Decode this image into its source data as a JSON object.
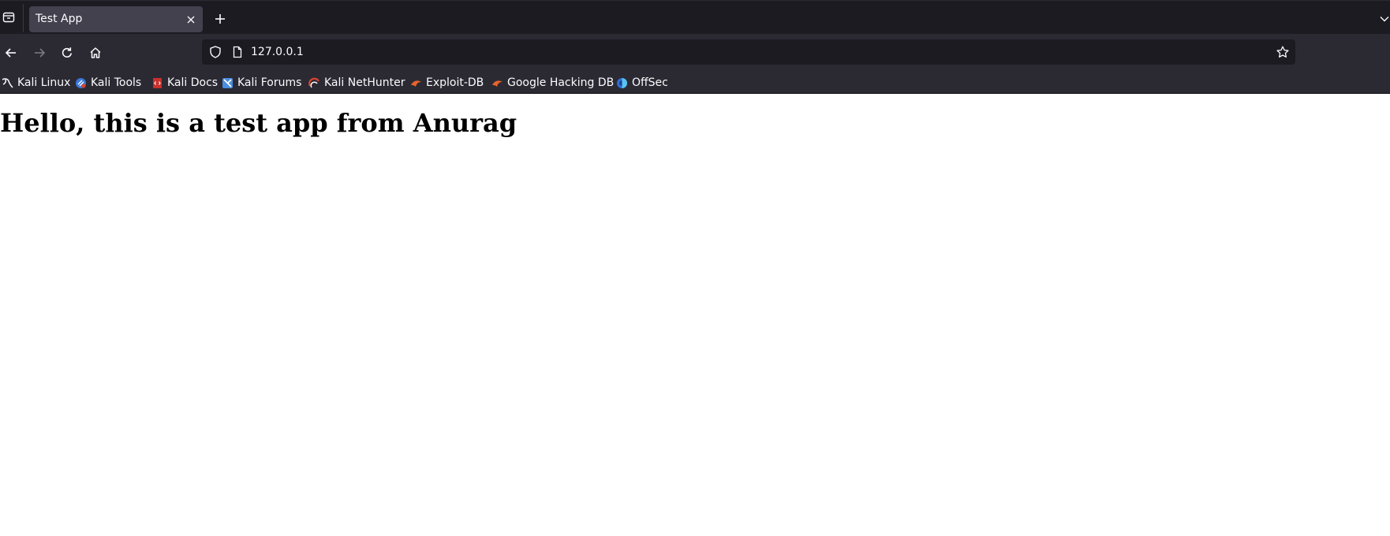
{
  "window": {
    "tab": {
      "title": "Test App"
    }
  },
  "urlbar": {
    "url": "127.0.0.1"
  },
  "bookmarks": [
    {
      "label": "Kali Linux",
      "icon": "kali-dragon-icon"
    },
    {
      "label": "Kali Tools",
      "icon": "kali-tools-icon"
    },
    {
      "label": "Kali Docs",
      "icon": "kali-docs-icon"
    },
    {
      "label": "Kali Forums",
      "icon": "kali-forums-icon"
    },
    {
      "label": "Kali NetHunter",
      "icon": "kali-nethunter-icon"
    },
    {
      "label": "Exploit-DB",
      "icon": "exploit-db-icon"
    },
    {
      "label": "Google Hacking DB",
      "icon": "ghdb-icon"
    },
    {
      "label": "OffSec",
      "icon": "offsec-icon"
    }
  ],
  "page": {
    "heading": "Hello, this is a test app from Anurag"
  },
  "colors": {
    "tabstrip_bg": "#1c1b22",
    "toolbar_bg": "#2b2a33",
    "active_tab_bg": "#42414d",
    "text": "#fbfbfe",
    "page_bg": "#ffffff"
  }
}
